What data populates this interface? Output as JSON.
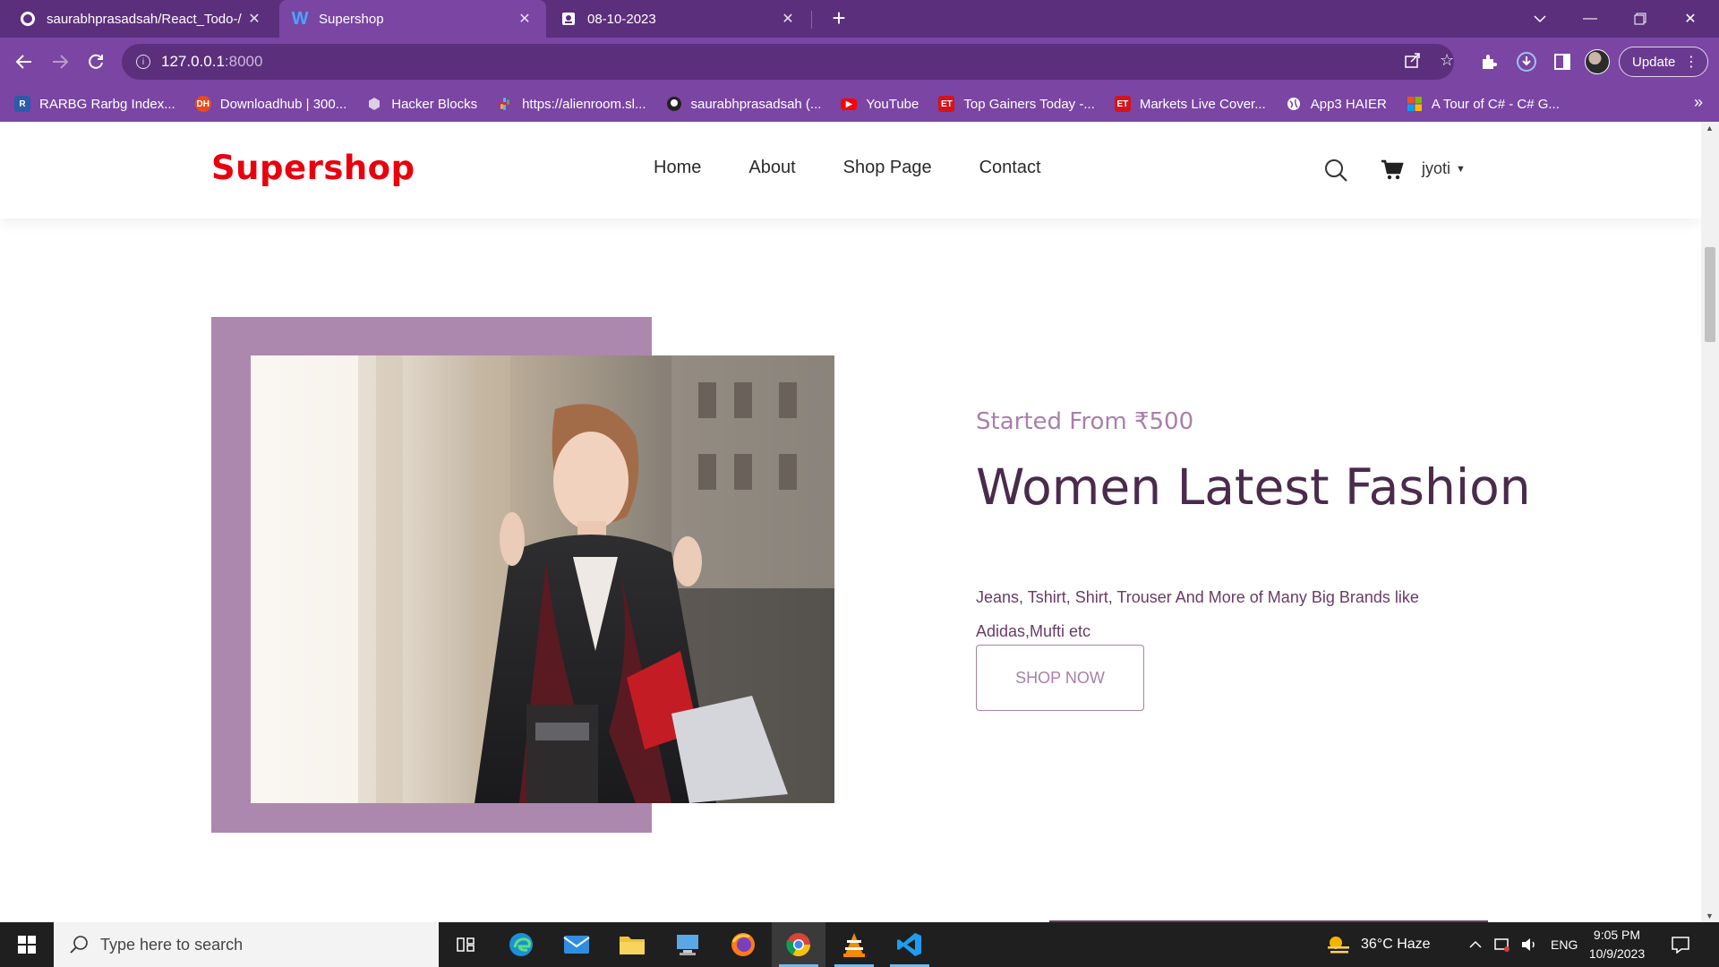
{
  "browser": {
    "tabs": [
      {
        "title": "saurabhprasadsah/React_Todo-/",
        "icon": "github-icon"
      },
      {
        "title": "Supershop",
        "icon": "w-icon",
        "active": true
      },
      {
        "title": "08-10-2023",
        "icon": "document-icon"
      }
    ],
    "url": {
      "host": "127.0.0.1",
      "port": ":8000"
    },
    "update_label": "Update",
    "bookmarks": [
      {
        "label": "RARBG Rarbg Index...",
        "icon": "r-icon",
        "color": "#2e5aa8"
      },
      {
        "label": "Downloadhub | 300...",
        "icon": "dh-icon",
        "color": "#e84b1c"
      },
      {
        "label": "Hacker Blocks",
        "icon": "hexagon-icon",
        "color": "#9a8fb0"
      },
      {
        "label": "https://alienroom.sl...",
        "icon": "slack-icon",
        "color": "#611f69"
      },
      {
        "label": "saurabhprasadsah (...",
        "icon": "github-icon",
        "color": "#222222"
      },
      {
        "label": "YouTube",
        "icon": "youtube-icon",
        "color": "#ff0000"
      },
      {
        "label": "Top Gainers Today -...",
        "icon": "et-icon",
        "color": "#d5131a"
      },
      {
        "label": "Markets Live Cover...",
        "icon": "et-icon",
        "color": "#d5131a"
      },
      {
        "label": "App3 HAIER",
        "icon": "globe-icon",
        "color": "#ffffff"
      },
      {
        "label": "A Tour of C# - C# G...",
        "icon": "microsoft-icon",
        "color": "#f25022"
      }
    ]
  },
  "site": {
    "logo": "Supershop",
    "nav": [
      "Home",
      "About",
      "Shop Page",
      "Contact"
    ],
    "user": "jyoti",
    "hero": {
      "subtitle": "Started From ₹500",
      "title": "Women Latest Fashion",
      "description": "Jeans, Tshirt, Shirt, Trouser And More of Many Big Brands like Adidas,Mufti etc",
      "button": "SHOP NOW",
      "frame_color": "#ad88ae",
      "accent_color": "#a880aa"
    }
  },
  "taskbar": {
    "search_placeholder": "Type here to search",
    "weather": "36°C  Haze",
    "language": "ENG",
    "time": "9:05 PM",
    "date": "10/9/2023"
  }
}
